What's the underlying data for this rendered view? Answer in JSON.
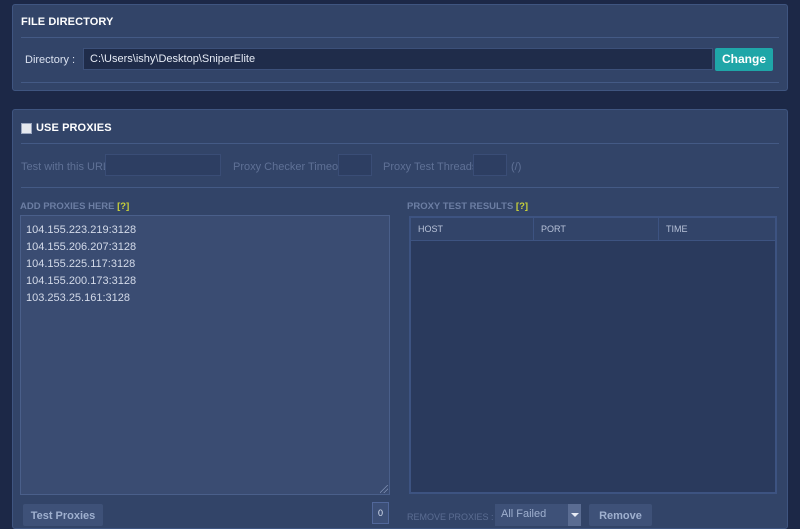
{
  "file_directory": {
    "title": "FILE DIRECTORY",
    "directory_label": "Directory :",
    "directory_value": "C:\\Users\\ishy\\Desktop\\SniperElite",
    "change_label": "Change"
  },
  "proxies": {
    "title": "USE PROXIES",
    "checked": false,
    "test_url_label": "Test with this URL:",
    "timeout_label": "Proxy Checker Timeout:",
    "threads_label": "Proxy Test Threads:",
    "threads_unit": "(/)",
    "add_label": "ADD PROXIES HERE",
    "help_mark": "[?]",
    "list": [
      "104.155.223.219:3128",
      "104.155.206.207:3128",
      "104.155.225.117:3128",
      "104.155.200.173:3128",
      "103.253.25.161:3128"
    ],
    "results_label": "PROXY TEST RESULTS",
    "columns": [
      "HOST",
      "PORT",
      "TIME"
    ],
    "test_button": "Test Proxies",
    "count": "0",
    "remove_label": "REMOVE PROXIES :",
    "remove_option": "All Failed",
    "remove_button": "Remove"
  },
  "colors": {
    "background": "#1c2847",
    "panel": "#324468",
    "accent": "#1fa6a8",
    "help": "#c9d23a"
  }
}
